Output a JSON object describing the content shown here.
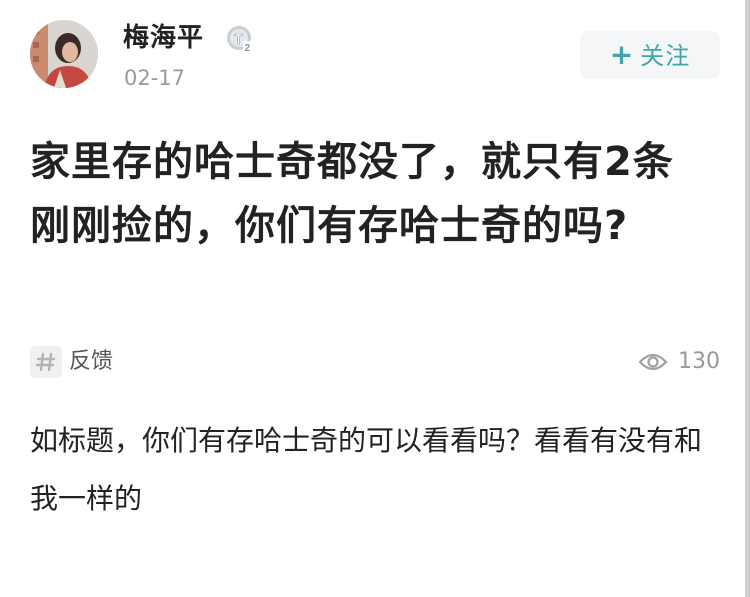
{
  "author": {
    "name": "梅海平",
    "badge_text": "T2",
    "date": "02-17"
  },
  "follow": {
    "icon": "+",
    "label": "关注"
  },
  "post": {
    "title": "家里存的哈士奇都没了，就只有2条刚刚捡的，你们有存哈士奇的吗?",
    "body": "如标题，你们有存哈士奇的可以看看吗？看看有没有和我一样的"
  },
  "tag": {
    "label": "反馈"
  },
  "stats": {
    "views": "130"
  },
  "colors": {
    "accent": "#3ea6aa",
    "follow_bg": "#f4f6f7",
    "muted": "#999999"
  }
}
